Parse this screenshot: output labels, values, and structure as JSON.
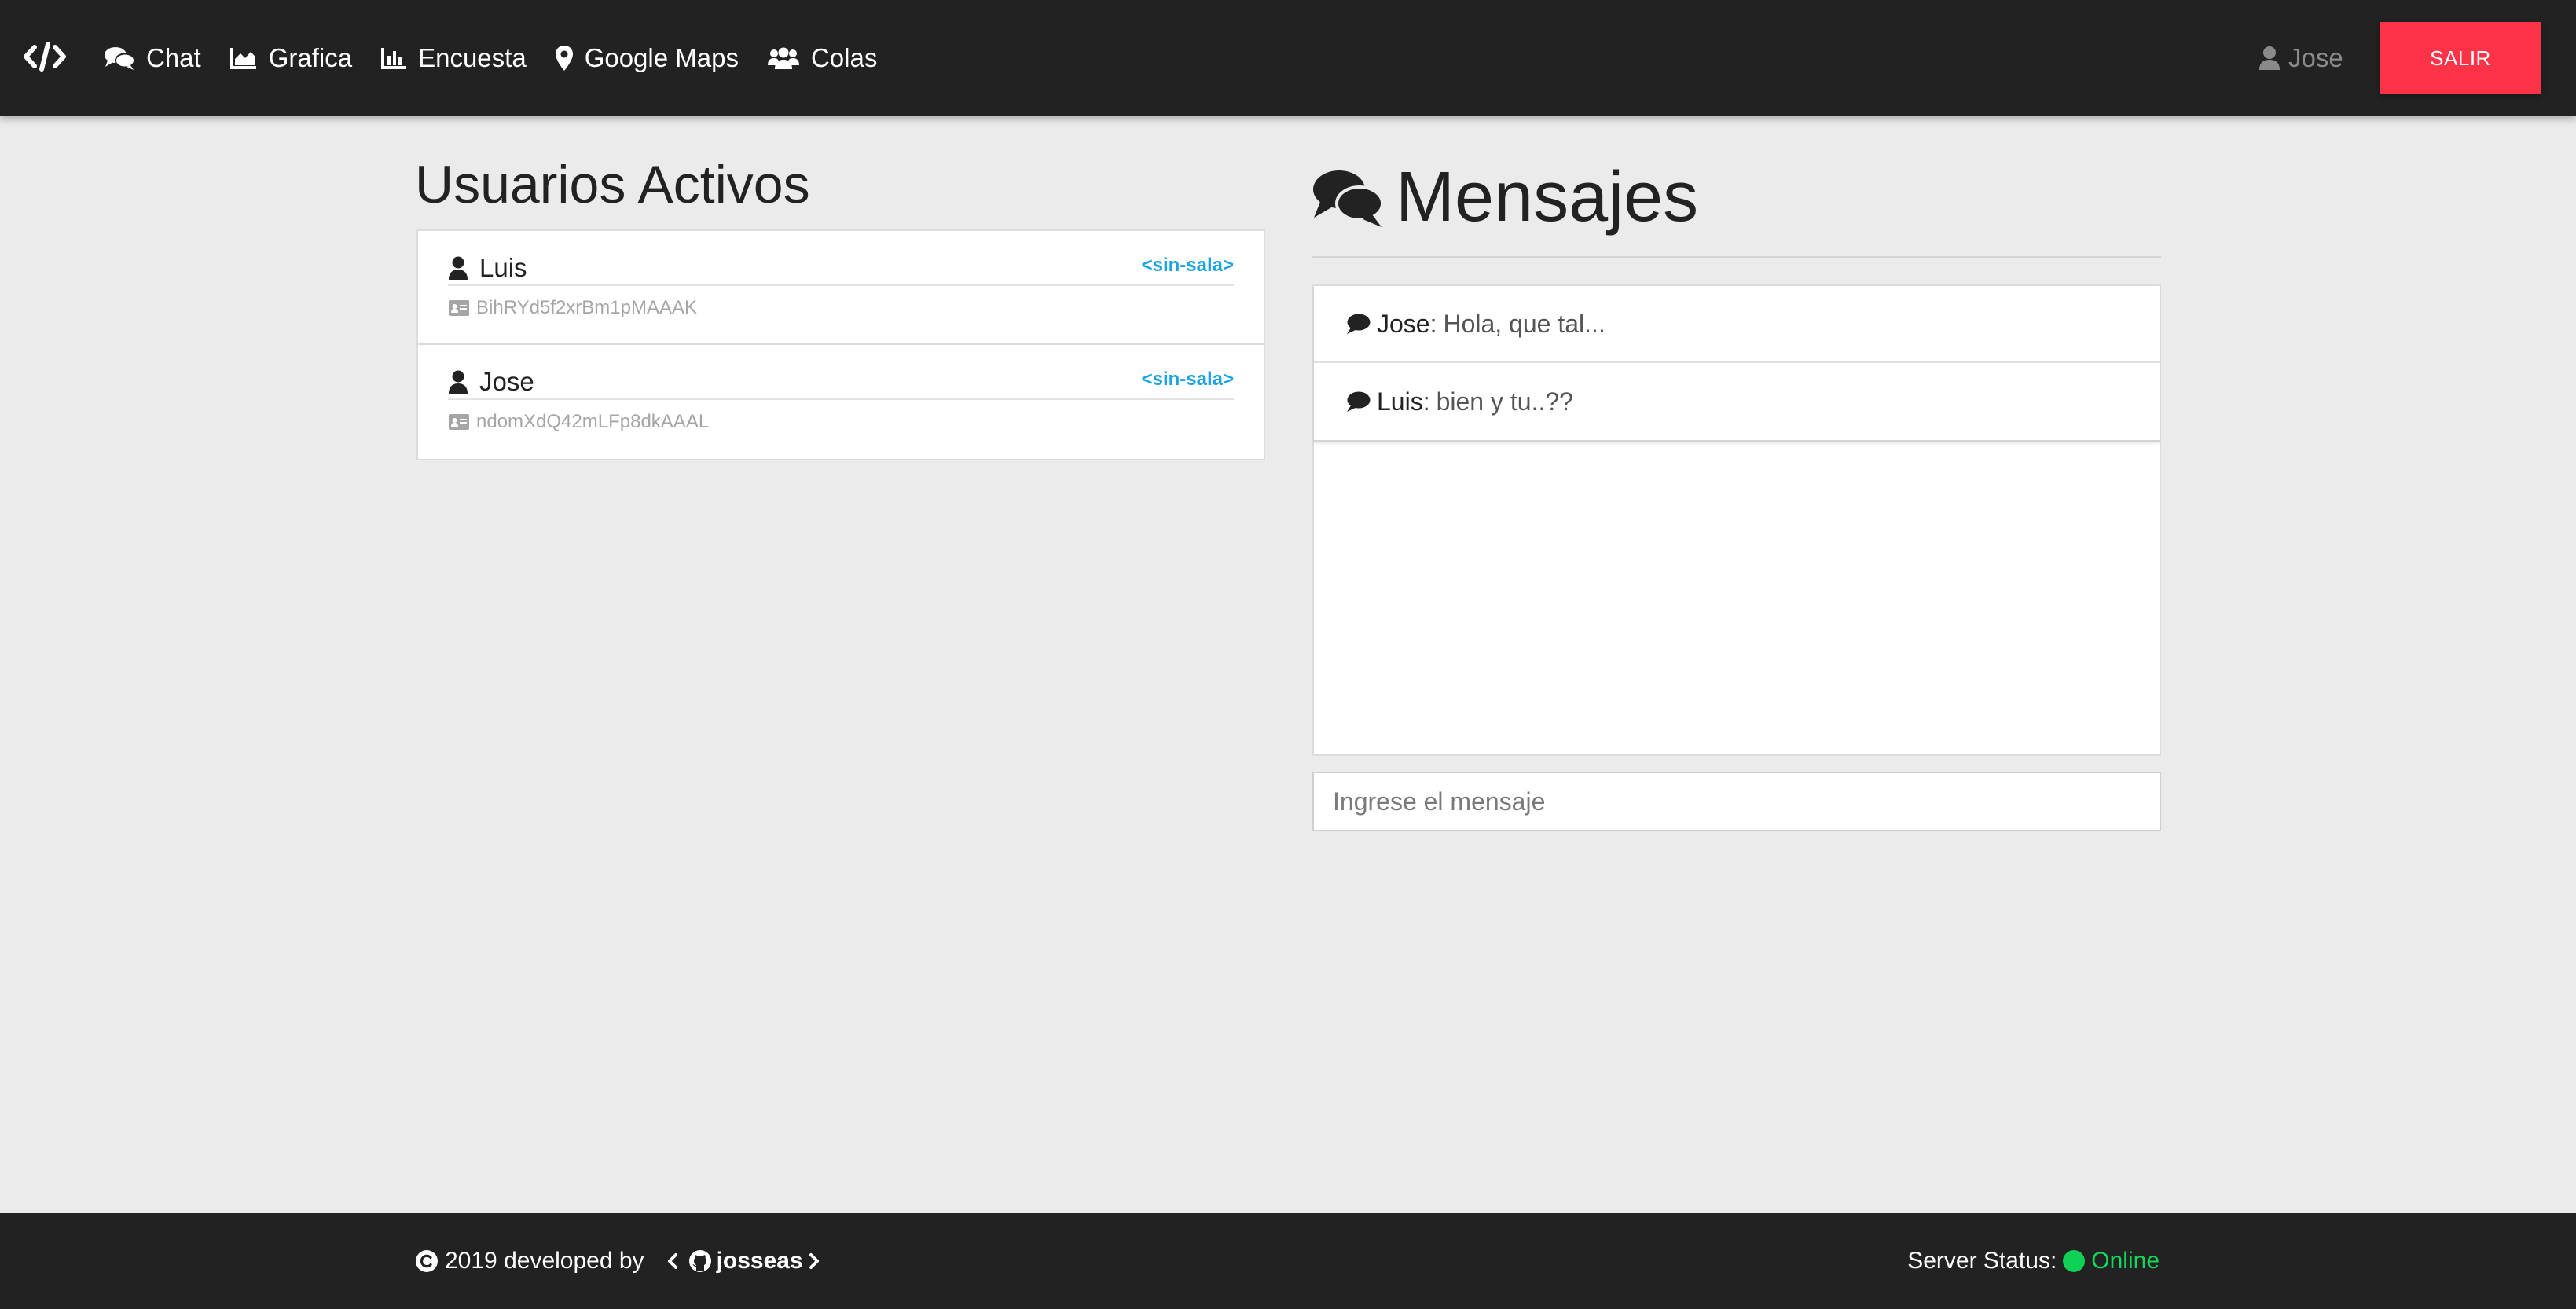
{
  "navbar": {
    "brand_icon": "code-icon",
    "items": [
      {
        "label": "Chat",
        "icon": "comments-icon"
      },
      {
        "label": "Grafica",
        "icon": "area-chart-icon"
      },
      {
        "label": "Encuesta",
        "icon": "bar-chart-icon"
      },
      {
        "label": "Google Maps",
        "icon": "map-marker-icon"
      },
      {
        "label": "Colas",
        "icon": "users-icon"
      }
    ],
    "user_name": "Jose",
    "logout_label": "SALIR"
  },
  "users_panel": {
    "title": "Usuarios Activos",
    "users": [
      {
        "name": "Luis",
        "room": "<sin-sala>",
        "id": "BihRYd5f2xrBm1pMAAAK"
      },
      {
        "name": "Jose",
        "room": "<sin-sala>",
        "id": "ndomXdQ42mLFp8dkAAAL"
      }
    ]
  },
  "messages_panel": {
    "title": "Mensajes",
    "messages": [
      {
        "author": "Jose",
        "separator": ":",
        "text": "Hola, que tal..."
      },
      {
        "author": "Luis",
        "separator": ":",
        "text": "bien y tu..??"
      }
    ],
    "input_placeholder": "Ingrese el mensaje"
  },
  "footer": {
    "copyright": "2019 developed by",
    "author_link": "josseas",
    "status_label": "Server Status:",
    "status_value": "Online",
    "status_color": "#0fd156"
  },
  "colors": {
    "navbar_bg": "#222222",
    "accent_danger": "#ff3348",
    "room_link": "#18a3e4",
    "page_bg": "#ebebeb"
  }
}
